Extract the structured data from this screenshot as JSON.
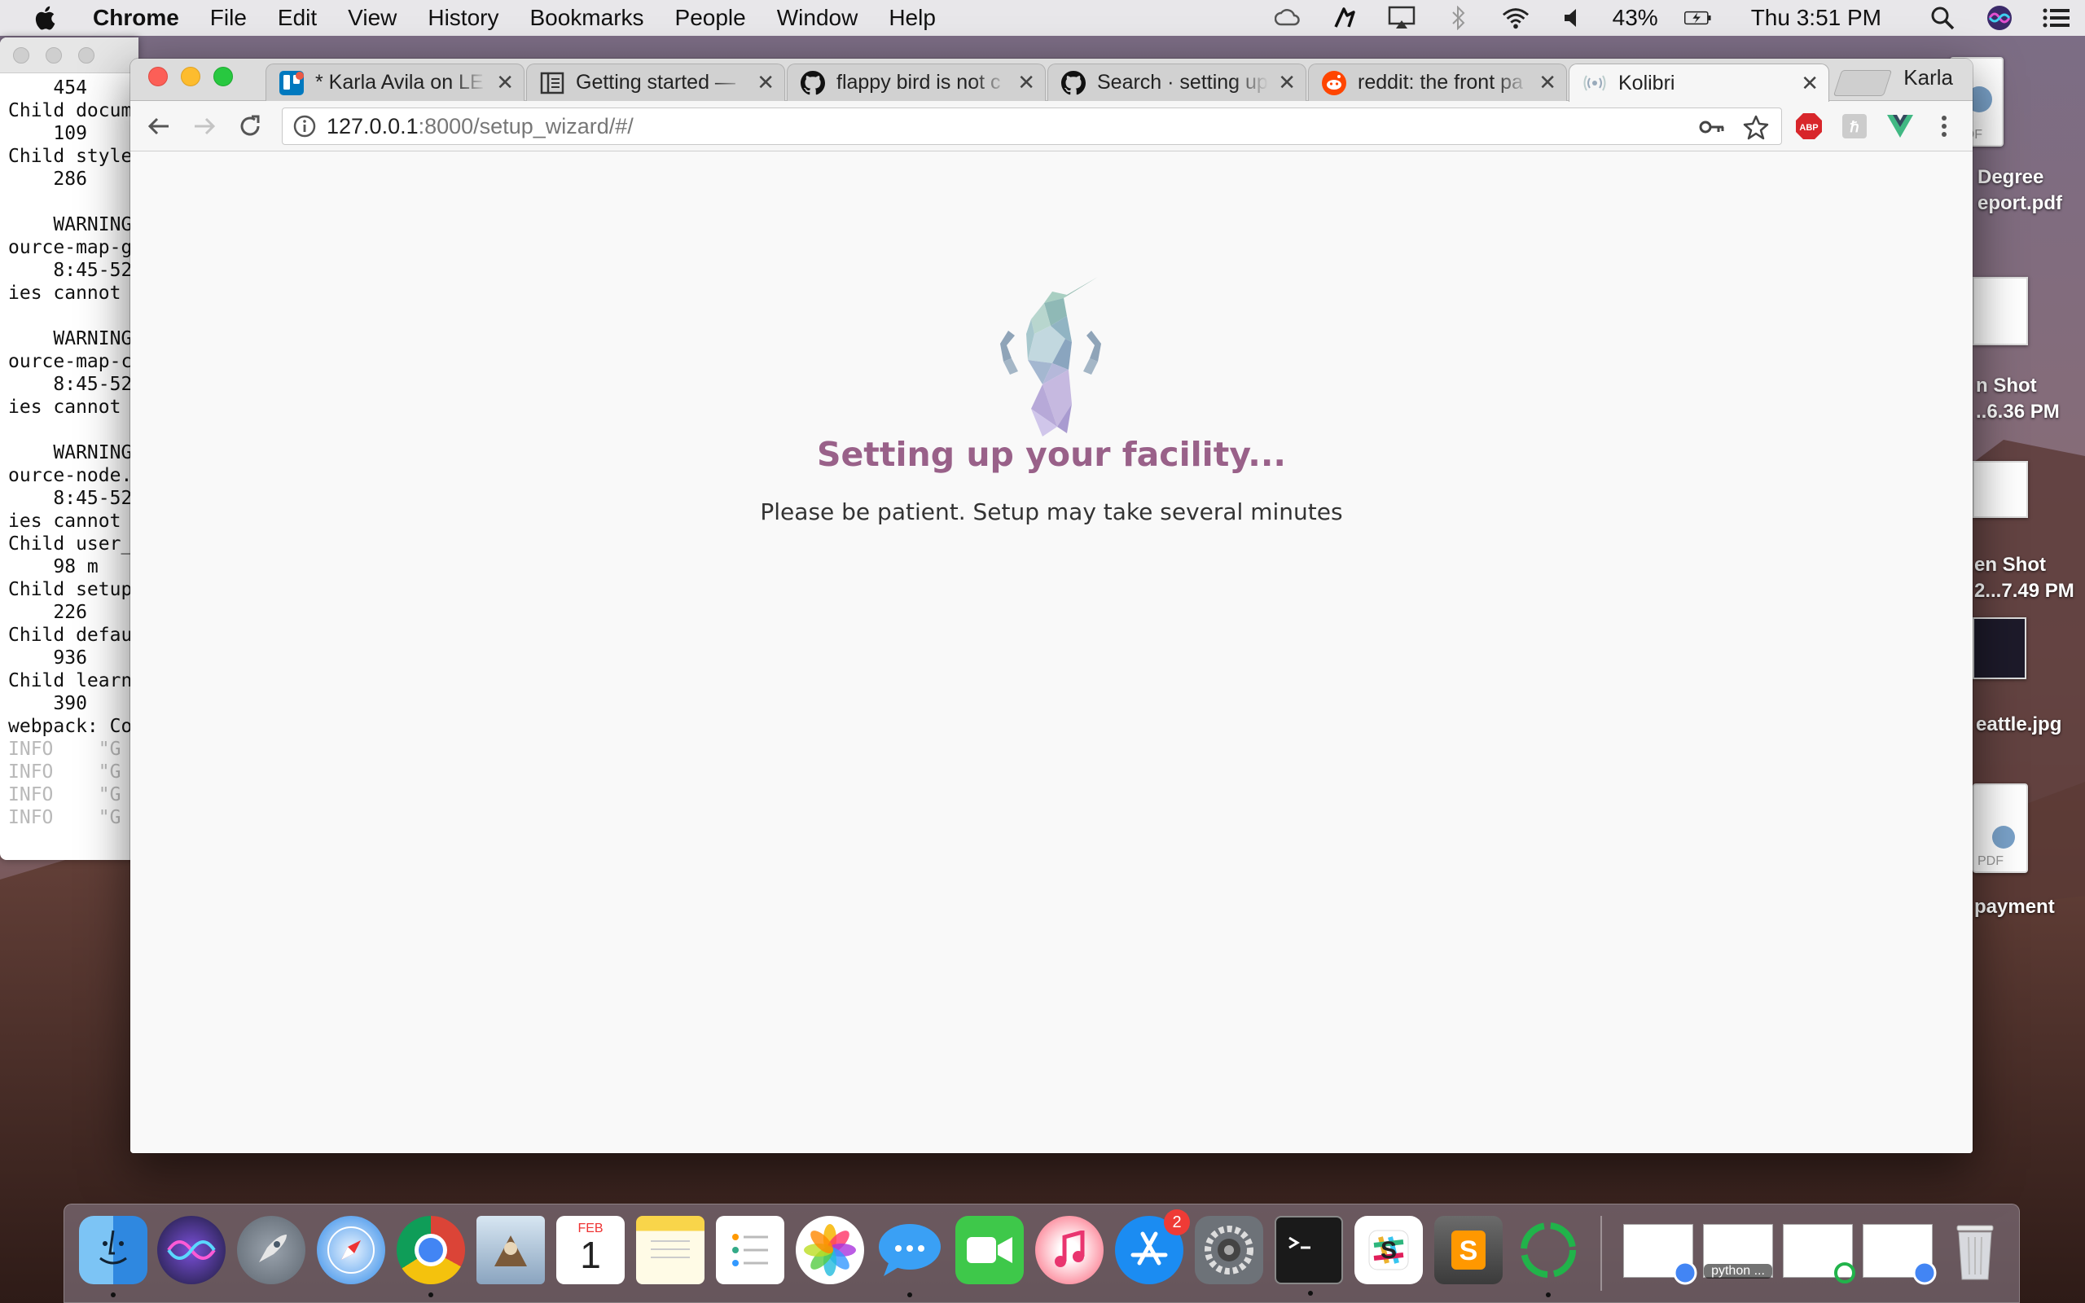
{
  "menubar": {
    "app_name": "Chrome",
    "items": [
      "File",
      "Edit",
      "View",
      "History",
      "Bookmarks",
      "People",
      "Window",
      "Help"
    ],
    "battery": "43%",
    "clock": "Thu 3:51 PM"
  },
  "terminal": {
    "lines": [
      "    454",
      "Child docum",
      "    109",
      "Child style",
      "    286",
      "",
      "    WARNING",
      "ource-map-g",
      "    8:45-52",
      "ies cannot",
      "",
      "    WARNING",
      "ource-map-c",
      "    8:45-52",
      "ies cannot",
      "",
      "    WARNING",
      "ource-node.",
      "    8:45-52",
      "ies cannot",
      "Child user_",
      "    98 m",
      "Child setup",
      "    226",
      "Child defau",
      "    936",
      "Child learn",
      "    390",
      "webpack: Co"
    ],
    "info_lines": [
      "INFO    \"G",
      "INFO    \"G",
      "INFO    \"G",
      "INFO    \"G"
    ]
  },
  "desktop": {
    "icon_labels": [
      "Degree",
      "eport.pdf",
      "n Shot",
      "..6.36 PM",
      "en Shot",
      "2...7.49 PM",
      "eattle.jpg",
      "payment"
    ],
    "pdf_label": "PDF"
  },
  "browser": {
    "tabs": [
      {
        "title": "* Karla Avila on LE",
        "icon": "trello-icon"
      },
      {
        "title": "Getting started —",
        "icon": "docs-icon"
      },
      {
        "title": "flappy bird is not c",
        "icon": "github-icon"
      },
      {
        "title": "Search · setting up",
        "icon": "github-icon"
      },
      {
        "title": "reddit: the front pa",
        "icon": "reddit-icon"
      },
      {
        "title": "Kolibri",
        "icon": "kolibri-loading-icon"
      }
    ],
    "profile_name": "Karla",
    "url_host": "127.0.0.1",
    "url_path": ":8000/setup_wizard/#/",
    "extensions": {
      "abp": "ABP"
    }
  },
  "page": {
    "title": "Setting up your facility...",
    "subtitle": "Please be patient. Setup may take several minutes"
  },
  "dock": {
    "calendar_month": "FEB",
    "calendar_day": "1",
    "appstore_badge": "2",
    "thumb_label": "python ..."
  },
  "colors": {
    "kolibri_purple": "#996189",
    "accent_blue": "#1a73e8"
  }
}
